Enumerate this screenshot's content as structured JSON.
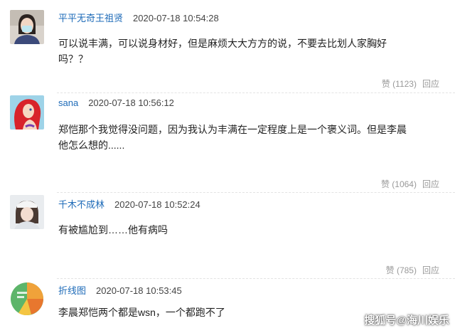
{
  "comments": [
    {
      "username": "平平无奇王祖贤",
      "time": "2020-07-18 10:54:28",
      "text": "可以说丰满，可以说身材好，但是麻烦大大方方的说，不要去比划人家胸好吗？？",
      "likes": "赞 (1123)",
      "reply": "回应",
      "avatar": "woman-avatar-icon"
    },
    {
      "username": "sana",
      "time": "2020-07-18 10:56:12",
      "text": "郑恺那个我觉得没问题，因为我认为丰满在一定程度上是一个褒义词。但是李晨他怎么想的......",
      "likes": "赞 (1064)",
      "reply": "回应",
      "avatar": "mermaid-avatar-icon"
    },
    {
      "username": "千木不成林",
      "time": "2020-07-18 10:52:24",
      "text": "有被尴尬到……他有病吗",
      "likes": "赞 (785)",
      "reply": "回应",
      "avatar": "girl-avatar-icon"
    },
    {
      "username": "折线图",
      "time": "2020-07-18 10:53:45",
      "text": "李晨郑恺两个都是wsn，一个都跑不了",
      "avatar": "pie-chart-avatar-icon"
    }
  ],
  "watermark": "搜狐号@海川娱乐",
  "colors": {
    "username": "#1e6bb8",
    "text": "#222222",
    "muted": "#999999"
  }
}
